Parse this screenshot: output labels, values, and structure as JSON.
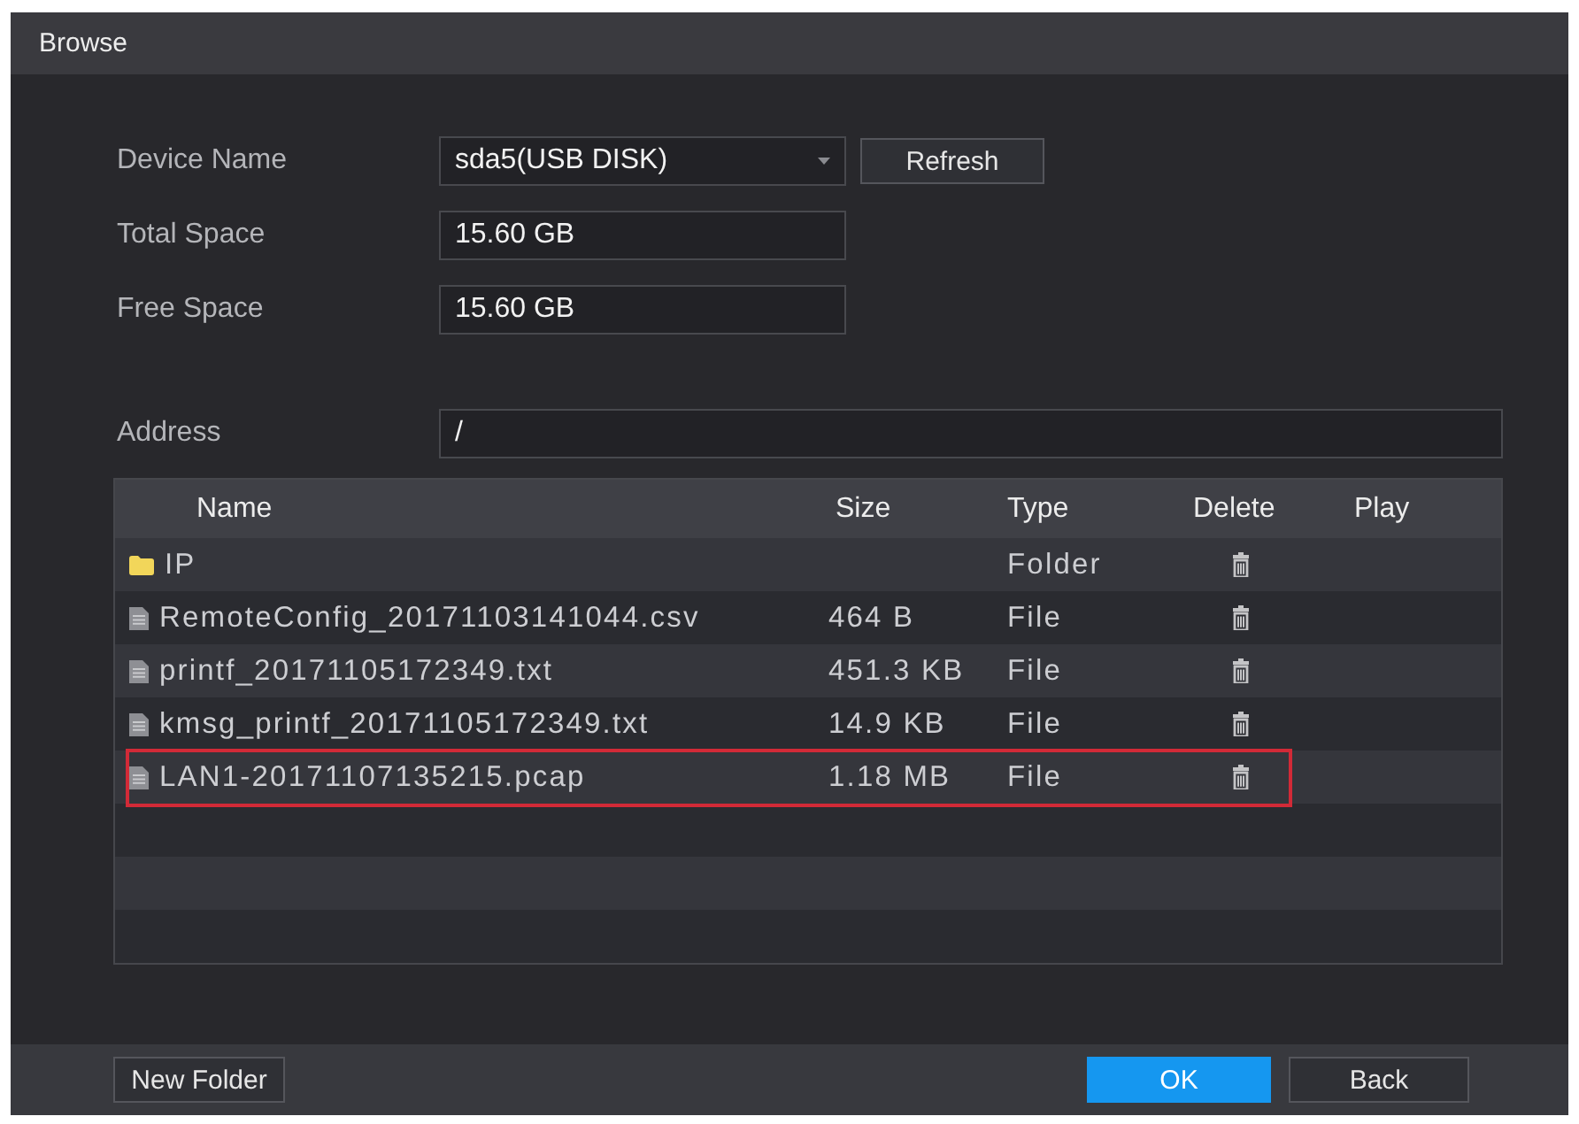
{
  "window": {
    "title": "Browse"
  },
  "fields": [
    {
      "kind": "dropdown",
      "label": "Device Name",
      "value": "sda5(USB DISK)",
      "button": "Refresh"
    },
    {
      "kind": "text",
      "label": "Total Space",
      "value": "15.60 GB"
    },
    {
      "kind": "text",
      "label": "Free Space",
      "value": "15.60 GB"
    }
  ],
  "address": {
    "label": "Address",
    "value": "/"
  },
  "table": {
    "columns": [
      "Name",
      "Size",
      "Type",
      "Delete",
      "Play"
    ],
    "rows": [
      {
        "kind": "folder",
        "name": "IP",
        "type": "Folder",
        "highlighted": false
      },
      {
        "kind": "file",
        "name": "RemoteConfig_20171103141044.csv",
        "size": "464 B",
        "type": "File",
        "highlighted": false
      },
      {
        "kind": "file",
        "name": "printf_20171105172349.txt",
        "size": "451.3 KB",
        "type": "File",
        "highlighted": false
      },
      {
        "kind": "file",
        "name": "kmsg_printf_20171105172349.txt",
        "size": "14.9 KB",
        "type": "File",
        "highlighted": false
      },
      {
        "kind": "file",
        "name": "LAN1-20171107135215.pcap",
        "size": "1.18 MB",
        "type": "File",
        "highlighted": true
      }
    ]
  },
  "footer": {
    "left_buttons": [
      {
        "label": "New Folder",
        "kind": "plain"
      }
    ],
    "right_buttons": [
      {
        "label": "OK",
        "kind": "primary"
      },
      {
        "label": "Back",
        "kind": "plain"
      }
    ]
  }
}
